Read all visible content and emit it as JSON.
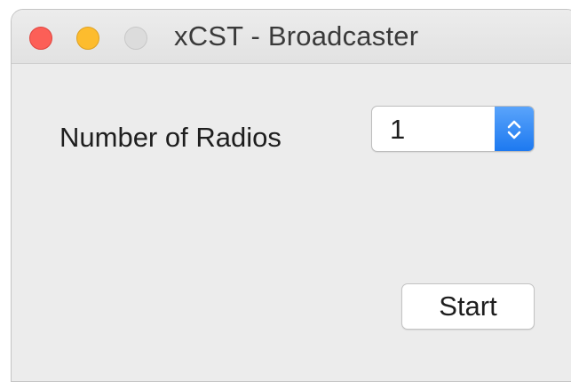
{
  "window": {
    "title": "xCST - Broadcaster",
    "controls": {
      "close_color": "#fc5f57",
      "minimize_color": "#fdbc2e",
      "zoom_color": "#dcdcdc"
    }
  },
  "form": {
    "radios_label": "Number of Radios",
    "radios_select": {
      "value": "1",
      "stepper_icon": "chevron-up-down-icon",
      "accent_color": "#1d79f0"
    },
    "start_label": "Start"
  }
}
